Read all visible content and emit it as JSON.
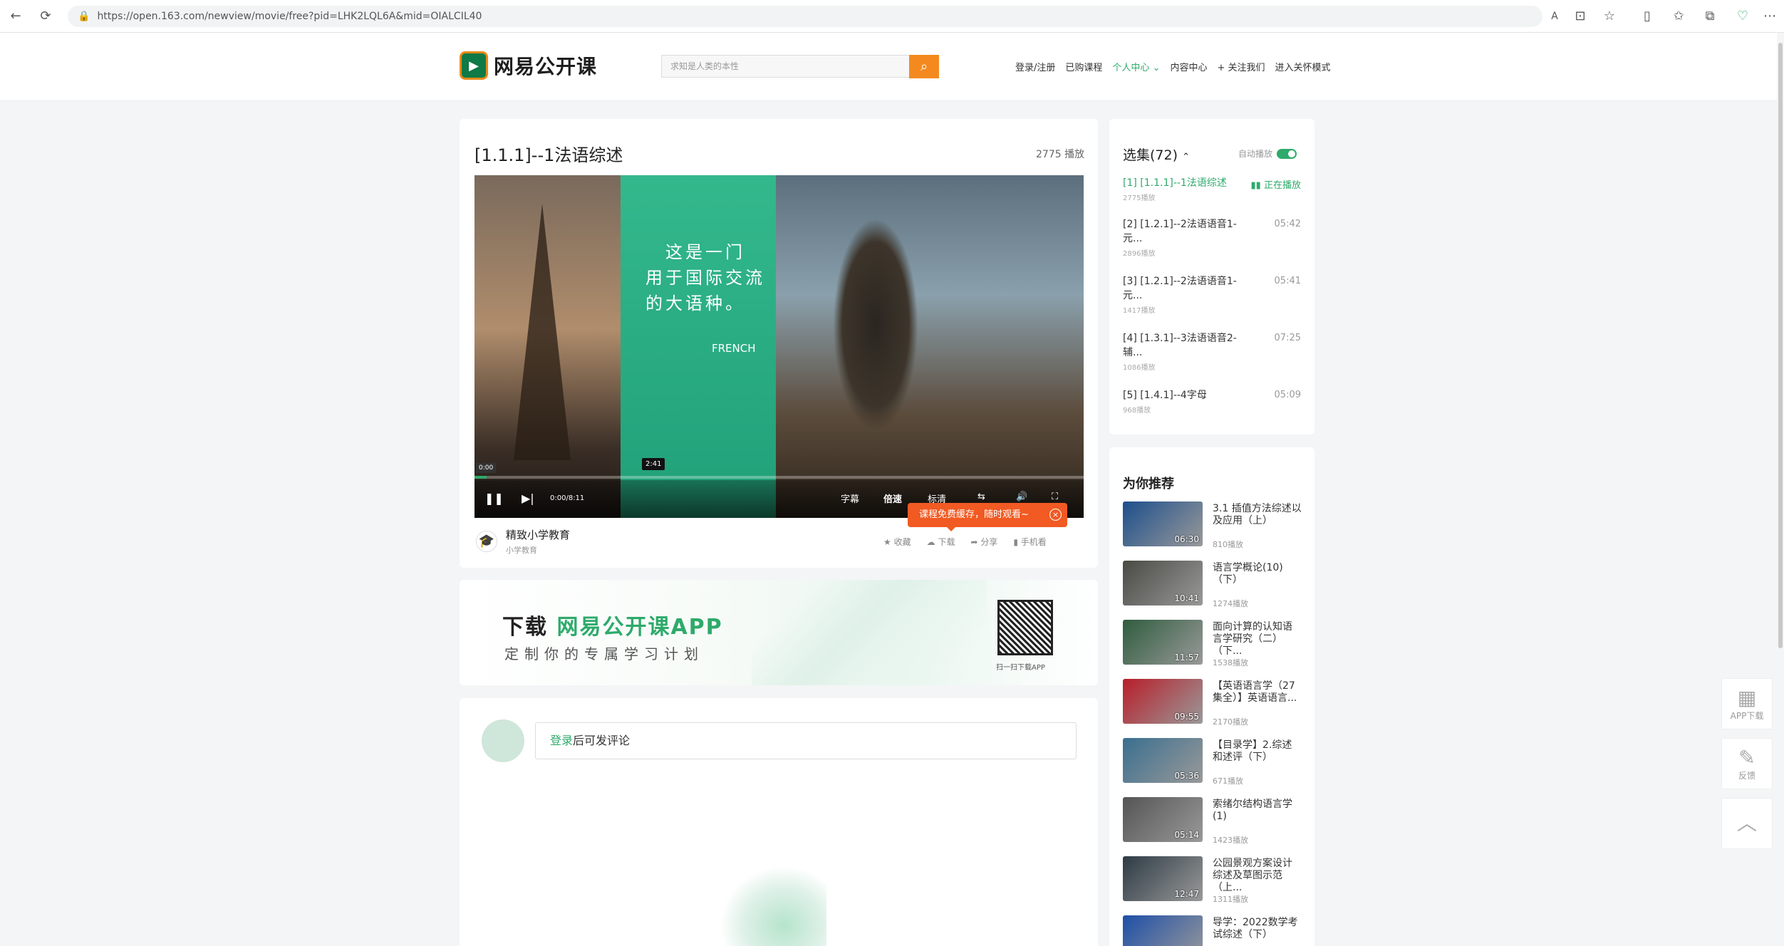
{
  "browser": {
    "url": "https://open.163.com/newview/movie/free?pid=LHK2LQL6A&mid=OIALCIL40"
  },
  "header": {
    "logo_text": "网易公开课",
    "search_placeholder": "求知是人类的本性",
    "nav": [
      "登录/注册",
      "已购课程",
      "个人中心",
      "内容中心",
      "+ 关注我们",
      "进入关怀模式"
    ],
    "accent": "#2eaa6b"
  },
  "video": {
    "title": "[1.1.1]--1法语综述",
    "play_count": "2775 播放",
    "overlay_text": [
      "这是一门",
      "用于国际交流",
      "的大语种。"
    ],
    "overlay_tag": "FRENCH",
    "time_tooltip_start": "0:00",
    "time_tooltip_hover": "2:41",
    "time": "0:00/8:11",
    "progress": 0.02,
    "controls": {
      "subtitle": "字幕",
      "speed": "倍速",
      "quality": "标清"
    },
    "toast": "课程免费缓存，随时观看~",
    "author_name": "精致小学教育",
    "author_sub": "小学教育",
    "actions": [
      "收藏",
      "下载",
      "分享",
      "手机看"
    ]
  },
  "banner": {
    "title_prefix": "下载",
    "title_highlight": "网易公开课APP",
    "subtitle": "定制你的专属学习计划",
    "qr_caption": "扫一扫下载APP"
  },
  "comment": {
    "login_link": "登录",
    "placeholder_rest": "后可发评论"
  },
  "playlist": {
    "heading": "选集(72)",
    "autoplay_label": "自动播放",
    "episodes": [
      {
        "title": "[1] [1.1.1]--1法语综述",
        "count": "2775播放",
        "duration": "正在播放",
        "active": true
      },
      {
        "title": "[2] [1.2.1]--2法语语音1-元...",
        "count": "2896播放",
        "duration": "05:42",
        "active": false
      },
      {
        "title": "[3] [1.2.1]--2法语语音1-元...",
        "count": "1417播放",
        "duration": "05:41",
        "active": false
      },
      {
        "title": "[4] [1.3.1]--3法语语音2-辅...",
        "count": "1086播放",
        "duration": "07:25",
        "active": false
      },
      {
        "title": "[5] [1.4.1]--4字母",
        "count": "968播放",
        "duration": "05:09",
        "active": false
      }
    ]
  },
  "recommend": {
    "heading": "为你推荐",
    "items": [
      {
        "title": "3.1 插值方法综述以及应用（上）",
        "count": "810播放",
        "duration": "06:30",
        "color": "#1d4f8c"
      },
      {
        "title": "语言学概论(10)（下）",
        "count": "1274播放",
        "duration": "10:41",
        "color": "#4a4a45"
      },
      {
        "title": "面向计算的认知语言学研究（二）（下...",
        "count": "1538播放",
        "duration": "11:57",
        "color": "#2f5d3e"
      },
      {
        "title": "【英语语言学（27集全）】英语语言...",
        "count": "2170播放",
        "duration": "09:55",
        "color": "#b81e2a"
      },
      {
        "title": "【目录学】2.综述和述评（下）",
        "count": "671播放",
        "duration": "05:36",
        "color": "#3a6f8f"
      },
      {
        "title": "索绪尔结构语言学(1)",
        "count": "1423播放",
        "duration": "05:14",
        "color": "#555555"
      },
      {
        "title": "公园景观方案设计综述及草图示范（上...",
        "count": "1311播放",
        "duration": "12:47",
        "color": "#2d3b45"
      },
      {
        "title": "导学：2022数学考试综述（下）",
        "count": "",
        "duration": "",
        "color": "#1e4fa8"
      }
    ]
  },
  "side": {
    "app_download": "APP下载",
    "feedback": "反馈"
  }
}
